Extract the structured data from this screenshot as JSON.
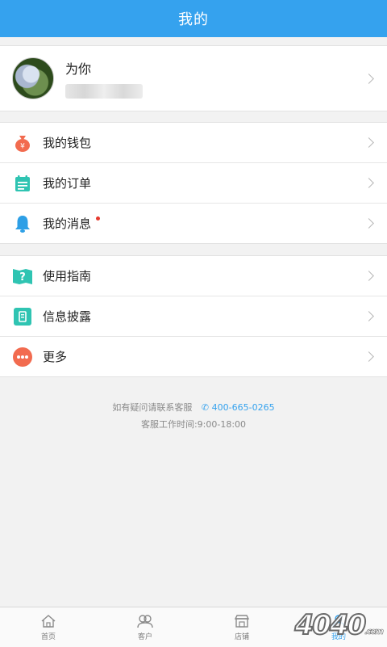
{
  "header": {
    "title": "我的"
  },
  "profile": {
    "name": "为你"
  },
  "menu_group1": [
    {
      "label": "我的钱包",
      "icon": "wallet-bag-icon",
      "color": "#f26b4f"
    },
    {
      "label": "我的订单",
      "icon": "order-clipboard-icon",
      "color": "#2fc4b2"
    },
    {
      "label": "我的消息",
      "icon": "bell-icon",
      "color": "#2d9fe6",
      "unread": true
    }
  ],
  "menu_group2": [
    {
      "label": "使用指南",
      "icon": "guide-book-icon",
      "color": "#2fc4b2"
    },
    {
      "label": "信息披露",
      "icon": "disclosure-icon",
      "color": "#2fc4b2"
    },
    {
      "label": "更多",
      "icon": "more-dots-icon",
      "color": "#f26b4f"
    }
  ],
  "help": {
    "prompt": "如有疑问请联系客服",
    "phone": "400-665-0265",
    "hours": "客服工作时间:9:00-18:00"
  },
  "tabbar": [
    {
      "label": "首页",
      "icon": "home-icon"
    },
    {
      "label": "客户",
      "icon": "customers-icon"
    },
    {
      "label": "店铺",
      "icon": "shop-icon"
    },
    {
      "label": "我的",
      "icon": "profile-icon",
      "active": true
    }
  ],
  "watermark": {
    "text": "4040",
    "suffix": ".com"
  },
  "colors": {
    "primary": "#35a2ee",
    "background": "#f2f2f2",
    "badge": "#e63a2e"
  }
}
